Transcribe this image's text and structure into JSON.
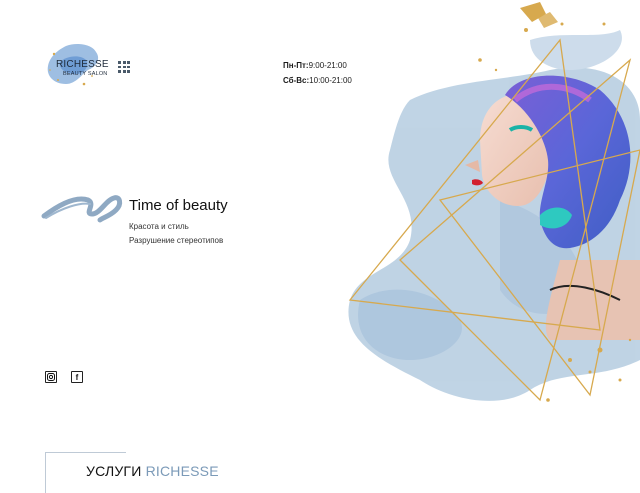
{
  "logo": {
    "title": "RICHESSE",
    "subtitle": "BEAUTY SALON"
  },
  "hours": {
    "weekdays_label": "Пн-Пт:",
    "weekdays_time": "9:00-21:00",
    "weekend_label": "Сб-Вс:",
    "weekend_time": "10:00-21:00"
  },
  "hero": {
    "title": "Time of beauty",
    "line1": "Красота и стиль",
    "line2": "Разрушение стереотипов"
  },
  "social": {
    "icons": [
      "instagram-icon",
      "facebook-icon"
    ],
    "facebook_glyph": "f"
  },
  "services": {
    "prefix": "УСЛУГИ",
    "brand": "RICHESSE"
  },
  "colors": {
    "accent_blue": "#7b9ab8",
    "gold": "#d7a94e",
    "watercolor": "#b9cfe2"
  }
}
